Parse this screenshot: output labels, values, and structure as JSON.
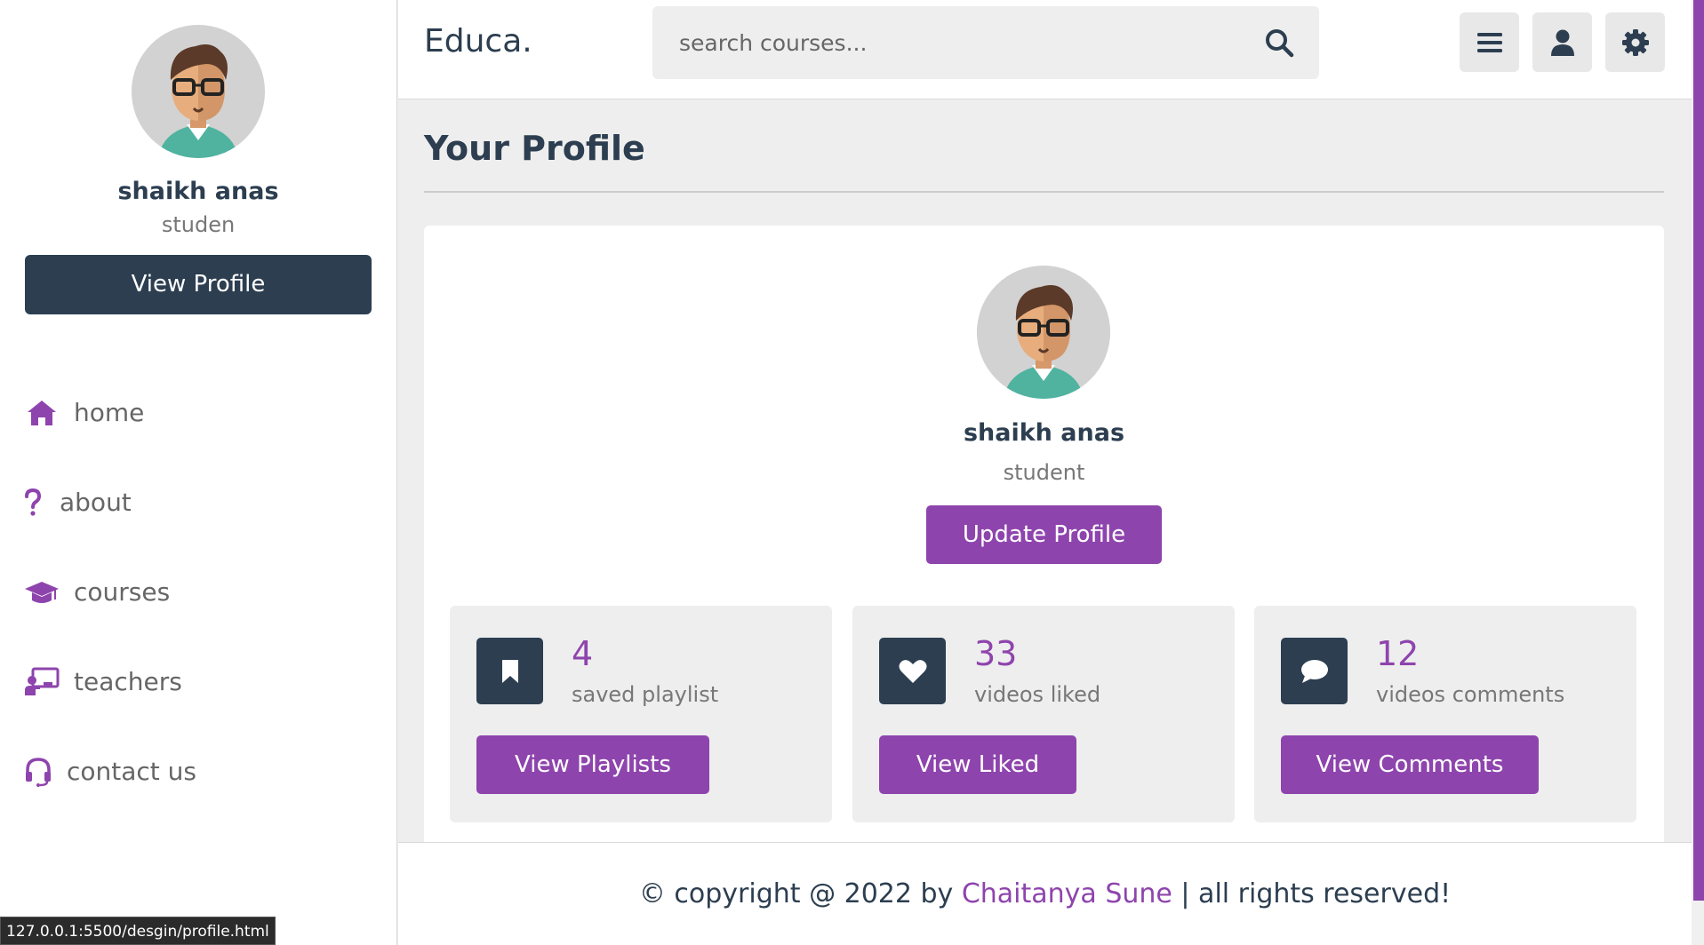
{
  "app": {
    "logo": "Educa."
  },
  "header": {
    "search_placeholder": "search courses...",
    "buttons": [
      "menu-icon",
      "user-icon",
      "gear-icon"
    ]
  },
  "sidebar": {
    "name": "shaikh anas",
    "role": "studen",
    "view_profile_label": "View Profile",
    "items": [
      {
        "label": "home",
        "icon": "home-icon"
      },
      {
        "label": "about",
        "icon": "question-icon"
      },
      {
        "label": "courses",
        "icon": "graduation-cap-icon"
      },
      {
        "label": "teachers",
        "icon": "chalkboard-teacher-icon"
      },
      {
        "label": "contact us",
        "icon": "headset-icon"
      }
    ]
  },
  "main": {
    "title": "Your Profile",
    "profile": {
      "name": "shaikh anas",
      "role": "student",
      "update_label": "Update Profile"
    },
    "stats": [
      {
        "number": "4",
        "label": "saved playlist",
        "button": "View Playlists",
        "icon": "bookmark-icon"
      },
      {
        "number": "33",
        "label": "videos liked",
        "button": "View Liked",
        "icon": "heart-icon"
      },
      {
        "number": "12",
        "label": "videos comments",
        "button": "View Comments",
        "icon": "comment-icon"
      }
    ]
  },
  "footer": {
    "prefix": "© copyright @ 2022 by ",
    "author": "Chaitanya Sune",
    "suffix": " | all rights reserved!"
  },
  "status_url": "127.0.0.1:5500/desgin/profile.html",
  "colors": {
    "accent": "#8e44ad",
    "dark": "#2c3e50",
    "background": "#eeeeee"
  }
}
